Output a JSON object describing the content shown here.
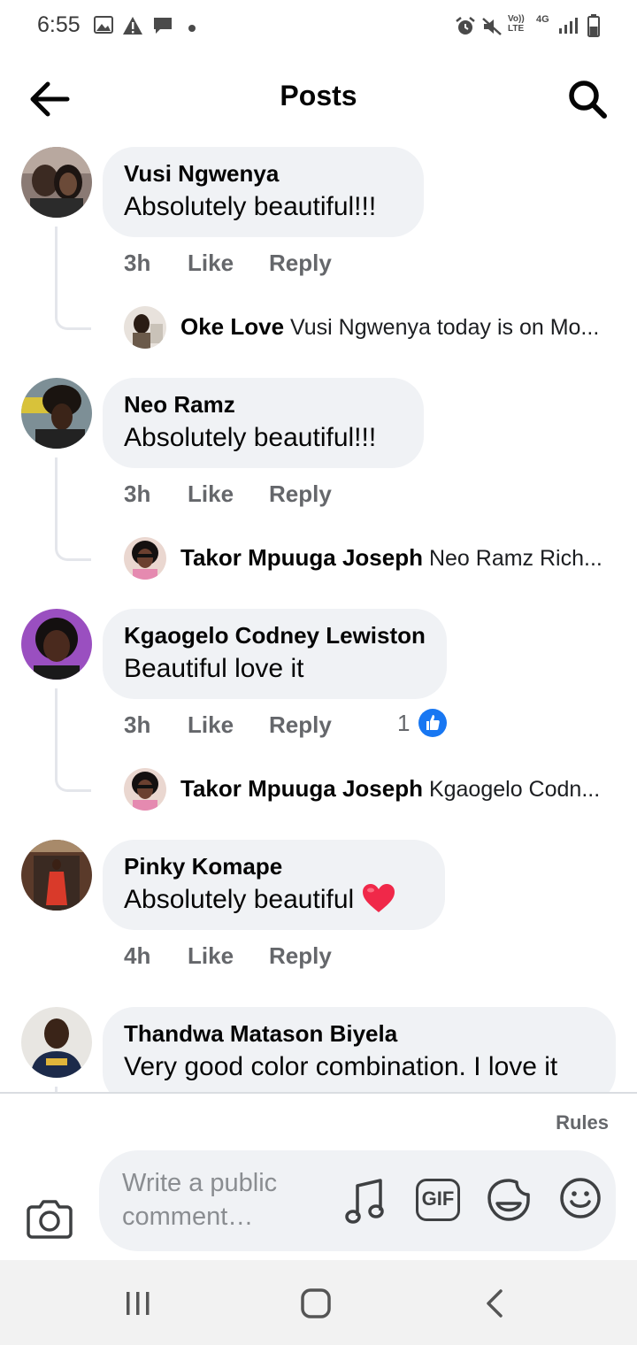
{
  "status_bar": {
    "time": "6:55",
    "left_icons": [
      "image-icon",
      "alert-icon",
      "message-icon",
      "dot-icon"
    ],
    "right_icons": [
      "alarm-icon",
      "mute-icon",
      "volte-icon",
      "4g-icon",
      "signal-icon",
      "battery-icon"
    ],
    "volte_label": "Vo))\nLTE",
    "network_label": "4G"
  },
  "header": {
    "title": "Posts"
  },
  "comments": [
    {
      "author": "Vusi Ngwenya",
      "text": "Absolutely beautiful!!!",
      "time": "3h",
      "like": "Like",
      "reply": "Reply",
      "reply_preview": {
        "author": "Oke Love",
        "text": "Vusi Ngwenya today is on Mo..."
      }
    },
    {
      "author": "Neo Ramz",
      "text": "Absolutely beautiful!!!",
      "time": "3h",
      "like": "Like",
      "reply": "Reply",
      "reply_preview": {
        "author": "Takor Mpuuga Joseph",
        "text": "Neo Ramz Rich..."
      }
    },
    {
      "author": "Kgaogelo Codney Lewiston",
      "text": "Beautiful love it",
      "time": "3h",
      "like": "Like",
      "reply": "Reply",
      "reaction_count": "1",
      "reply_preview": {
        "author": "Takor Mpuuga Joseph",
        "text": "Kgaogelo Codn..."
      }
    },
    {
      "author": "Pinky Komape",
      "text": "Absolutely beautiful",
      "time": "4h",
      "like": "Like",
      "reply": "Reply"
    },
    {
      "author": "Thandwa Matason Biyela",
      "text": "Very good color combination. I love it"
    }
  ],
  "composer": {
    "rules_label": "Rules",
    "placeholder": "Write a public comment…",
    "gif_label": "GIF"
  },
  "colors": {
    "bubble": "#f0f2f5",
    "meta": "#65676b",
    "like_blue": "#1877f2",
    "heart": "#f02849"
  }
}
